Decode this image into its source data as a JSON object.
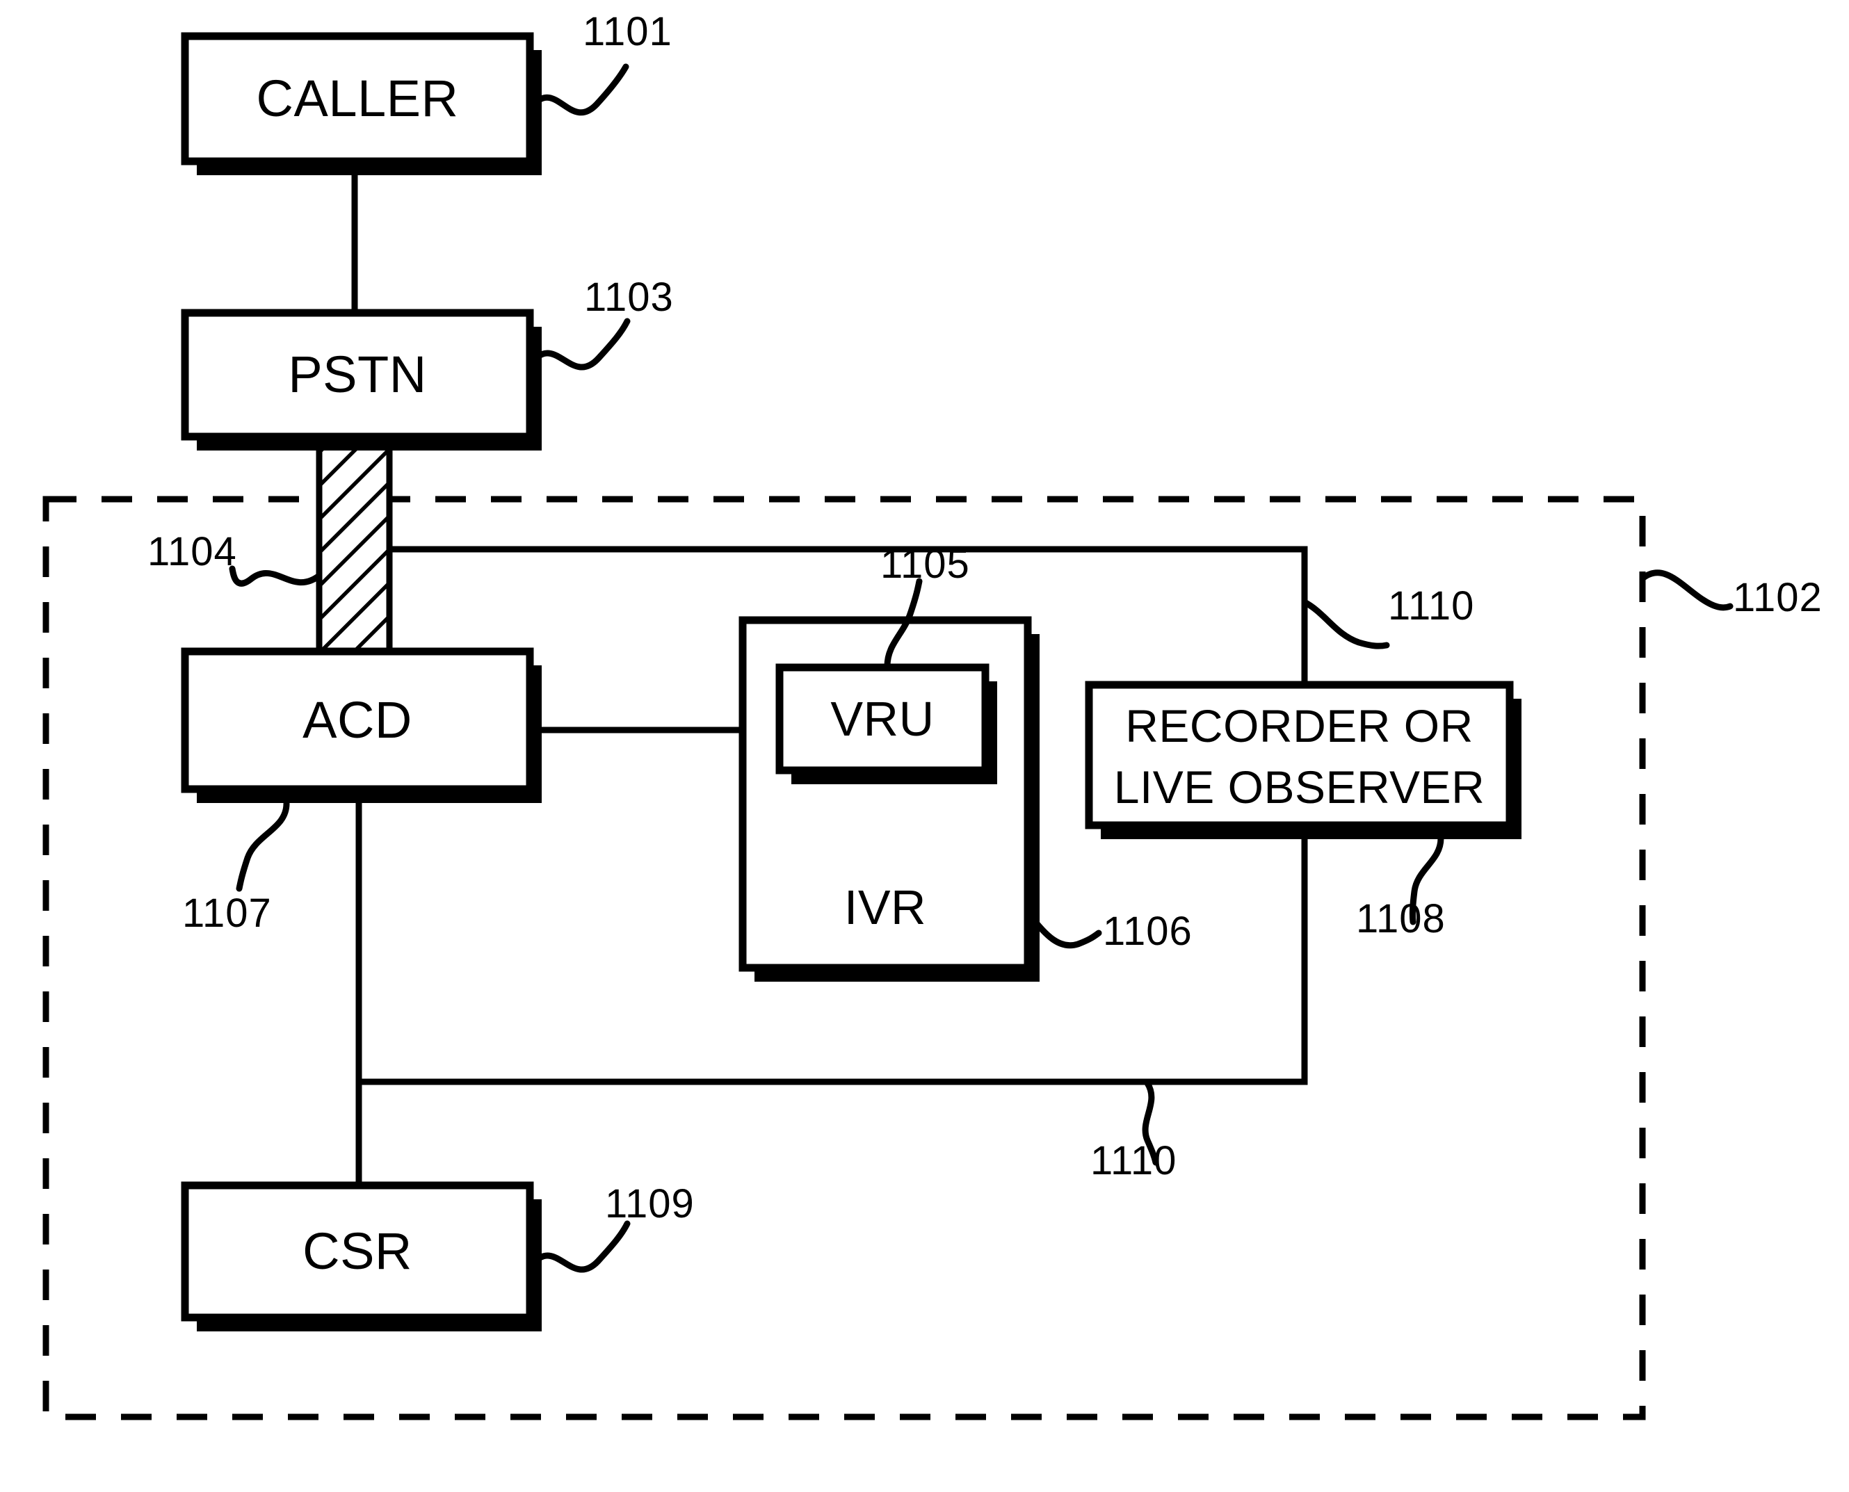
{
  "figure": {
    "type": "patent-block-diagram",
    "description": "Call center block diagram showing caller routed through PSTN into a call center containing ACD, IVR with VRU, recorder or live observer, and CSR"
  },
  "boxes": [
    {
      "id": "caller",
      "label": "CALLER",
      "ref": "1101"
    },
    {
      "id": "pstn",
      "label": "PSTN",
      "ref": "1103"
    },
    {
      "id": "acd",
      "label": "ACD",
      "ref": "1107"
    },
    {
      "id": "ivr",
      "label": "IVR",
      "ref": "1106"
    },
    {
      "id": "vru",
      "label": "VRU",
      "ref": "1105"
    },
    {
      "id": "recorder",
      "label_line1": "RECORDER OR",
      "label_line2": "LIVE OBSERVER",
      "ref": "1108"
    },
    {
      "id": "csr",
      "label": "CSR",
      "ref": "1109"
    }
  ],
  "labels": {
    "caller": "CALLER",
    "pstn": "PSTN",
    "acd": "ACD",
    "ivr": "IVR",
    "vru": "VRU",
    "recorder_line1": "RECORDER OR",
    "recorder_line2": "LIVE OBSERVER",
    "csr": "CSR"
  },
  "refs": {
    "caller": "1101",
    "call_center_boundary": "1102",
    "pstn": "1103",
    "trunk": "1104",
    "vru": "1105",
    "ivr": "1106",
    "acd": "1107",
    "recorder": "1108",
    "csr": "1109",
    "link_upper": "1110",
    "link_lower": "1110"
  },
  "style": {
    "stroke": "#000000",
    "fill": "#ffffff",
    "shadow": "#000000"
  }
}
